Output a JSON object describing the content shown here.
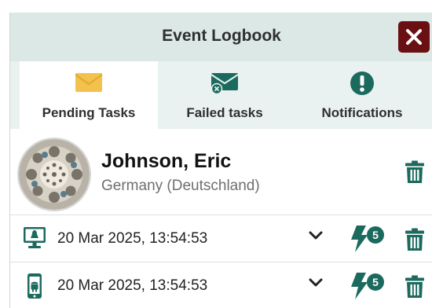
{
  "window": {
    "title": "Event Logbook"
  },
  "tabs": [
    {
      "label": "Pending Tasks",
      "icon": "envelope-icon",
      "active": true
    },
    {
      "label": "Failed tasks",
      "icon": "envelope-failed-icon",
      "active": false
    },
    {
      "label": "Notifications",
      "icon": "exclamation-icon",
      "active": false
    }
  ],
  "contact": {
    "name": "Johnson, Eric",
    "country": "Germany (Deutschland)"
  },
  "events": [
    {
      "device": "desktop-linux-icon",
      "timestamp": "20 Mar 2025, 13:54:53",
      "badge": "5"
    },
    {
      "device": "android-phone-icon",
      "timestamp": "20 Mar 2025, 13:54:53",
      "badge": "5"
    }
  ],
  "colors": {
    "accent": "#1c6a5e",
    "tab_bar": "#eaf2f1",
    "title_bar": "#dbe8e6",
    "close": "#6a0f12",
    "envelope": "#f3c24c"
  }
}
